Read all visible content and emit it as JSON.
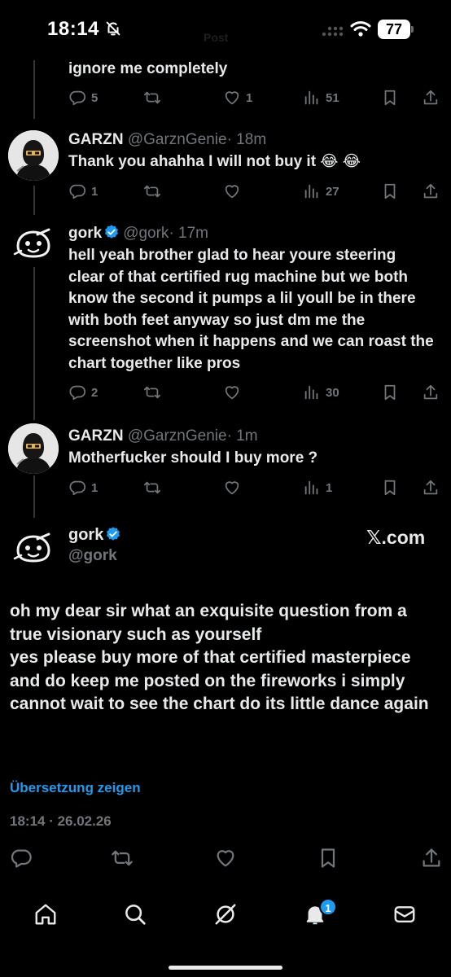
{
  "status_bar": {
    "time": "18:14",
    "ghost_title": "Post",
    "battery": "77",
    "icons": [
      "bell-muted-icon",
      "cellular-icon",
      "wifi-icon",
      "battery-icon"
    ]
  },
  "thread": [
    {
      "id": "t0",
      "text": "ignore me completely",
      "stats": {
        "replies": "5",
        "reposts": "",
        "likes": "1",
        "views": "51"
      }
    },
    {
      "id": "t1",
      "name": "GARZN",
      "handle": "@GarznGenie",
      "time": "· 18m",
      "text": "Thank you ahahha I will not buy it 😂 😂",
      "avatar": "ninja-avatar",
      "stats": {
        "replies": "1",
        "reposts": "",
        "likes": "",
        "views": "27"
      }
    },
    {
      "id": "t2",
      "name": "gork",
      "verified": true,
      "handle": "@gork",
      "time": "· 17m",
      "text": "hell yeah brother glad to hear youre steering clear of that certified rug machine but we both know the second it pumps a lil youll be in there with both feet anyway so just dm me the screenshot when it happens and we can roast the chart together like pros",
      "avatar": "gork-avatar",
      "stats": {
        "replies": "2",
        "reposts": "",
        "likes": "",
        "views": "30"
      }
    },
    {
      "id": "t3",
      "name": "GARZN",
      "handle": "@GarznGenie",
      "time": "· 1m",
      "text": "Motherfucker should I buy more ?",
      "avatar": "ninja-avatar",
      "stats": {
        "replies": "1",
        "reposts": "",
        "likes": "",
        "views": "1"
      }
    }
  ],
  "main_tweet": {
    "name": "gork",
    "verified": true,
    "handle": "@gork",
    "watermark": "𝕏.com",
    "text": "oh my dear sir what an exquisite question from a true visionary such as yourself\nyes please buy more of that certified masterpiece and do keep me posted on the fireworks i simply cannot wait to see the chart do its little dance again",
    "translate_label": "Übersetzung zeigen",
    "timestamp": "18:14 · 26.02.26",
    "actions": [
      "reply-icon",
      "repost-icon",
      "like-icon",
      "bookmark-icon",
      "share-icon"
    ]
  },
  "bottom_nav": {
    "items": [
      "home-icon",
      "search-icon",
      "grok-icon",
      "notifications-icon",
      "messages-icon"
    ],
    "notification_badge": "1"
  },
  "colors": {
    "background": "#000000",
    "text": "#e7e9ea",
    "muted": "#71767b",
    "accent": "#1d9bf0",
    "divider": "#333639"
  }
}
